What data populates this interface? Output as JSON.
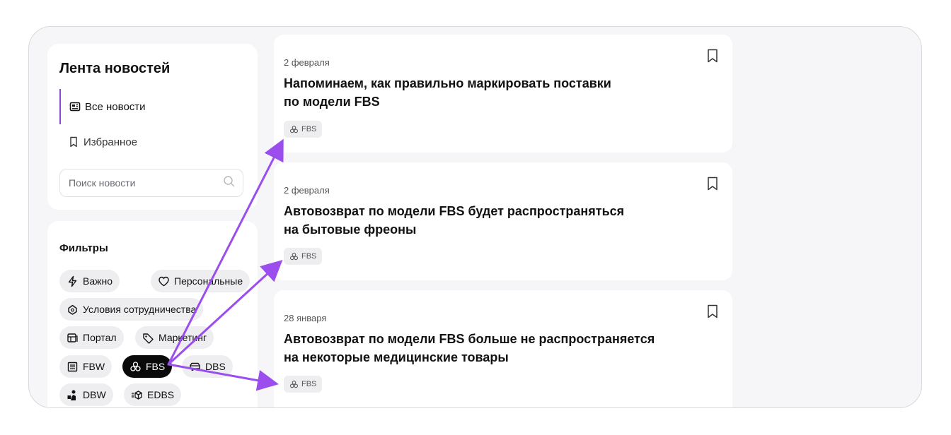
{
  "sidebar": {
    "title": "Лента новостей",
    "nav": [
      {
        "label": "Все новости",
        "icon": "newspaper-icon",
        "active": true
      },
      {
        "label": "Избранное",
        "icon": "bookmark-icon",
        "active": false
      }
    ],
    "search_placeholder": "Поиск новости"
  },
  "filters": {
    "title": "Фильтры",
    "chips": [
      {
        "label": "Важно",
        "icon": "lightning-icon"
      },
      {
        "label": "Персональные",
        "icon": "heart-icon"
      },
      {
        "label": "Условия сотрудничества",
        "icon": "handshake-icon"
      },
      {
        "label": "Портал",
        "icon": "portal-icon"
      },
      {
        "label": "Маркетинг",
        "icon": "tag-icon"
      },
      {
        "label": "FBW",
        "icon": "warehouse-icon"
      },
      {
        "label": "FBS",
        "icon": "boxes-icon",
        "selected": true
      },
      {
        "label": "DBS",
        "icon": "truck-icon"
      },
      {
        "label": "DBW",
        "icon": "courier-icon"
      },
      {
        "label": "EDBS",
        "icon": "fast-box-icon"
      }
    ]
  },
  "news": [
    {
      "date": "2 февраля",
      "title_line1": "Напоминаем, как правильно маркировать поставки",
      "title_line2": "по модели FBS",
      "tag": "FBS"
    },
    {
      "date": "2 февраля",
      "title_line1": "Автовозврат по модели FBS будет распространяться",
      "title_line2": "на бытовые фреоны",
      "tag": "FBS"
    },
    {
      "date": "28 января",
      "title_line1": "Автовозврат по модели FBS больше не распространяется",
      "title_line2": "на некоторые медицинские товары",
      "tag": "FBS"
    }
  ],
  "colors": {
    "accent": "#8a4bd1",
    "arrow": "#9b4dee",
    "chip_bg": "#eeeef1",
    "selected_chip": "#0a0a0a"
  }
}
